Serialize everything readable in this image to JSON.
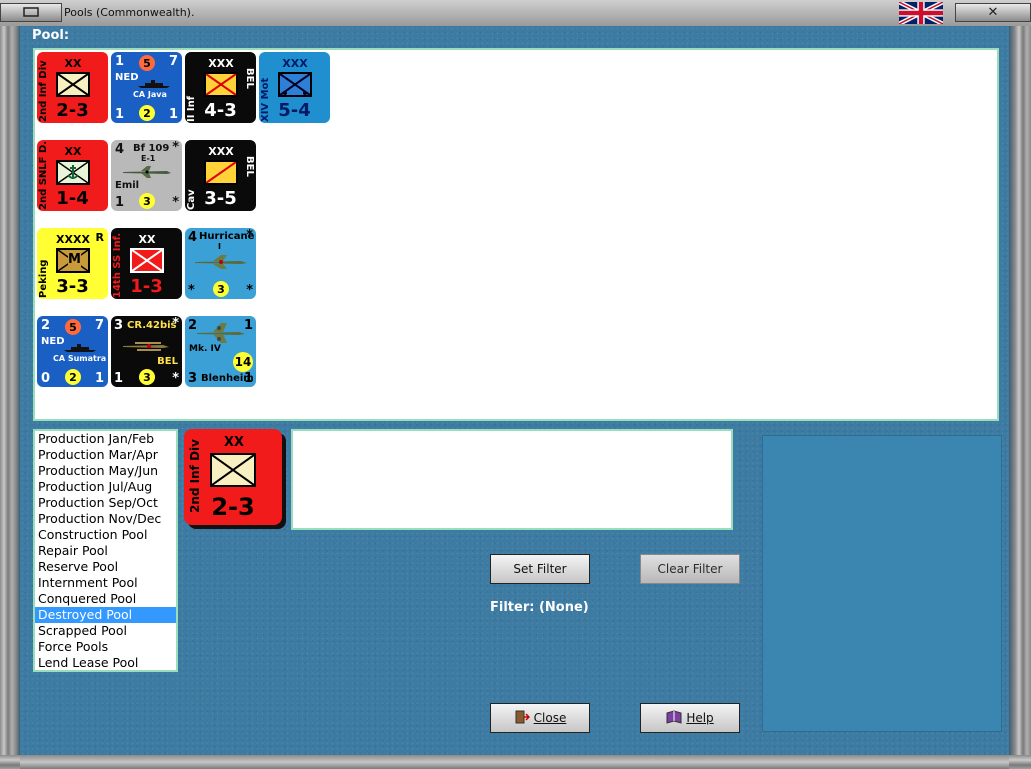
{
  "window": {
    "title": "Pools (Commonwealth).",
    "left_button_icon": "restore-icon",
    "right_button_icon": "close-icon"
  },
  "pool_section": {
    "label": "Pool:"
  },
  "counters": [
    {
      "id": "2nd-inf-div",
      "size": "XX",
      "side": "2nd Inf Div",
      "strength": "2-3",
      "color": "#f21b1b"
    },
    {
      "id": "ned-ca-java",
      "top_left": "1",
      "top_right": "7",
      "nation": "NED",
      "dot_top": "5",
      "ship_name": "CA Java",
      "bottom_left": "1",
      "dot_bottom": "2",
      "bottom_right": "1"
    },
    {
      "id": "ii-inf",
      "size": "XXX",
      "side": "II Inf",
      "side_right": "BEL",
      "strength": "4-3"
    },
    {
      "id": "xiv-mot",
      "size": "XXX",
      "side": "XIV Mot",
      "strength": "5-4"
    },
    {
      "id": "2nd-snlf",
      "size": "XX",
      "side": "2nd SNLF D.",
      "strength": "1-4"
    },
    {
      "id": "bf109",
      "top_left": "4",
      "top_right": "*",
      "aircraft": "Bf 109",
      "variant": "E-1",
      "nickname": "Emil",
      "bottom_left": "1",
      "dot_bottom": "3",
      "bottom_right": "*"
    },
    {
      "id": "cav-bel",
      "size": "XXX",
      "side": "Cav",
      "side_right": "BEL",
      "strength": "3-5"
    },
    {
      "id": "peking",
      "size": "XXXX",
      "corner": "R",
      "unit_letter": "M",
      "side": "Peking",
      "strength": "3-3"
    },
    {
      "id": "14th-ss-inf",
      "size": "XX",
      "side": "14th SS Inf.",
      "strength": "1-3"
    },
    {
      "id": "hurricane",
      "top_left": "4",
      "top_right": "*",
      "aircraft": "Hurricane",
      "variant": "I",
      "bottom_left": "*",
      "dot_bottom": "3",
      "bottom_right": "*"
    },
    {
      "id": "ned-ca-sumatra",
      "top_left": "2",
      "top_right": "7",
      "nation": "NED",
      "dot_top": "5",
      "ship_name": "CA Sumatra",
      "bottom_left": "0",
      "dot_bottom": "2",
      "bottom_right": "1"
    },
    {
      "id": "cr42bis",
      "top_left": "3",
      "top_right": "*",
      "aircraft": "CR.42bis",
      "nation": "BEL",
      "bottom_left": "1",
      "dot_bottom": "3",
      "bottom_right": "*"
    },
    {
      "id": "blenheim",
      "top_left": "2",
      "top_right": "1",
      "variant": "Mk. IV",
      "dot_top": "14",
      "aircraft": "Blenheim",
      "bottom_left": "3",
      "bottom_right": "1"
    }
  ],
  "pool_list": {
    "items": [
      "Production Jan/Feb",
      "Production Mar/Apr",
      "Production May/Jun",
      "Production Jul/Aug",
      "Production Sep/Oct",
      "Production Nov/Dec",
      "Construction Pool",
      "Repair Pool",
      "Reserve Pool",
      "Internment Pool",
      "Conquered Pool",
      "Destroyed Pool",
      "Scrapped Pool",
      "Force Pools",
      "Lend Lease Pool"
    ],
    "selected": "Destroyed Pool"
  },
  "selected_counter": {
    "size": "XX",
    "side": "2nd Inf Div",
    "strength": "2-3"
  },
  "buttons": {
    "set_filter": "Set Filter",
    "clear_filter": "Clear Filter",
    "close": "Close",
    "help": "Help"
  },
  "filter": {
    "text": "Filter: (None)"
  },
  "colors": {
    "panel_bg": "#3d7ba3",
    "selection": "#3399ff"
  }
}
